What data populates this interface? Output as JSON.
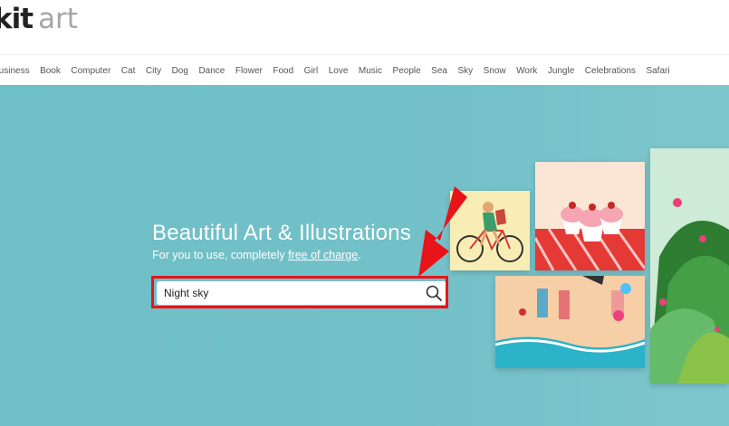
{
  "header": {
    "logo_bold": "kit",
    "logo_light": "art"
  },
  "nav": {
    "items": [
      "Business",
      "Book",
      "Computer",
      "Cat",
      "City",
      "Dog",
      "Dance",
      "Flower",
      "Food",
      "Girl",
      "Love",
      "Music",
      "People",
      "Sea",
      "Sky",
      "Snow",
      "Work",
      "Jungle",
      "Celebrations",
      "Safari"
    ]
  },
  "hero": {
    "title": "Beautiful Art & Illustrations",
    "subtitle_prefix": "For you to use, completely ",
    "subtitle_link": "free of charge",
    "subtitle_suffix": ".",
    "search_value": "Night sky"
  },
  "colors": {
    "hero_bg": "#72c0c8",
    "highlight": "#e8141a",
    "nav_text": "#555555"
  }
}
